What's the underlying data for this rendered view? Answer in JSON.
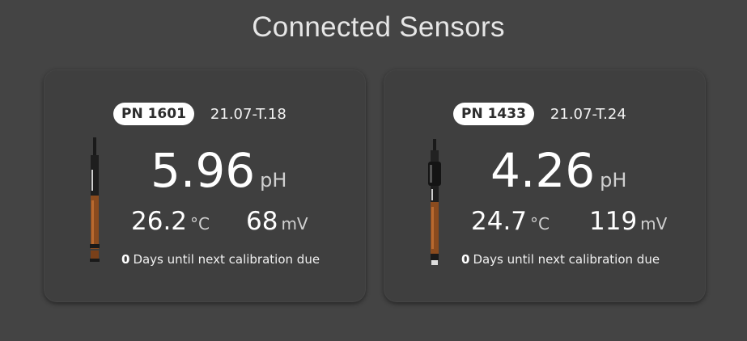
{
  "page": {
    "title": "Connected Sensors"
  },
  "colors": {
    "background": "#444444",
    "card": "#3f3f3f",
    "badge_bg": "#ffffff",
    "badge_text": "#2d2d2d"
  },
  "sensors": [
    {
      "pn": "PN 1601",
      "serial": "21.07-T.18",
      "ph_value": "5.96",
      "ph_unit": "pH",
      "temp_value": "26.2",
      "temp_unit": "°C",
      "mv_value": "68",
      "mv_unit": "mV",
      "days_value": "0",
      "days_text": "Days until next calibration due",
      "probe_icon": "ph-electrode-icon"
    },
    {
      "pn": "PN 1433",
      "serial": "21.07-T.24",
      "ph_value": "4.26",
      "ph_unit": "pH",
      "temp_value": "24.7",
      "temp_unit": "°C",
      "mv_value": "119",
      "mv_unit": "mV",
      "days_value": "0",
      "days_text": "Days until next calibration due",
      "probe_icon": "ph-electrode-with-cap-icon"
    }
  ]
}
